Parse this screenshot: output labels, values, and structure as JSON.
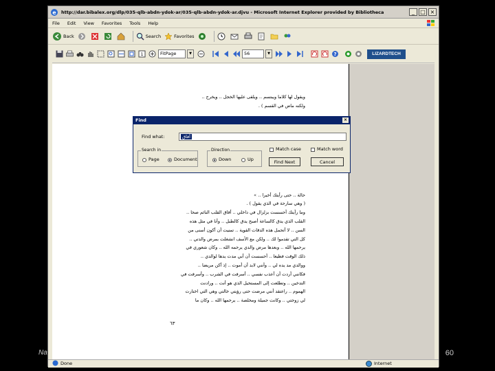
{
  "browser": {
    "title": "http://dar.bibalex.org/dlp/035-qlb-abdn-ydok-ar/035-qlb-abdn-ydok-ar.djvu - Microsoft Internet Explorer provided by Bibliotheca",
    "menu": [
      "File",
      "Edit",
      "View",
      "Favorites",
      "Tools",
      "Help"
    ],
    "toolbar": {
      "back": "Back",
      "search": "Search",
      "favorites": "Favorites"
    }
  },
  "viewer_toolbar": {
    "zoom_value": "FitPage",
    "page_value": "56",
    "logo": "LIZARDTECH"
  },
  "document": {
    "lines_top": [
      "ويقول لها كلاما ويبتسم .. ويلقى عليها الخجل .. ويخرج ..",
      "ولكنه ماض في القسم ) ."
    ],
    "lines_bottom": [
      "حالة .. حتى رأيتك أخيرا .. »",
      "( وهي سارحة في الذي يقول ) .",
      "وما رأيتك أحسست بزلزال في داخلي .. أفاق القلب النائم صحا ..",
      "القلب الذي يدق كالساعة أصبح يدق كالطبل .. وأنا في مثل هذه",
      "السن .. لا أتحمل هذه الدقات القوية .. تمنيت أن أكون أسنى من",
      "كل التي تقدموا لك .. ولكن مع الأسف انشغلت بمرض والدتي ..",
      "يرحمها الله .. وبعدها مرض والدي يرحمه الله .. وكان شعوري في",
      "ذلك الوقت فظيعا .. أحسست أن أبي مدت يدها لوالدي ..",
      "ووالدي مد يده لي .. وأنني لابد أن أموت .. إذ أكن مريضا ..",
      "فكانني أردت أن أعذب نفسي .. أسرفت في الشرب .. وأسرفت في",
      "التدخين .. وتطلعت إلى المستحيل الذي هو أنت .. ورادنت",
      "الهموم .. راعتقد أنني مرضت حتى رؤيتي خالتي وهي التي اختارت",
      "لي زوجتي .. وكانت جميلة ومخلصة .. يرحمها الله .. وكان ما"
    ],
    "page_number": "٦٣"
  },
  "find_dialog": {
    "title": "Find",
    "find_what_label": "Find what:",
    "find_value": "أفاق",
    "search_in_label": "Search in",
    "opt_page": "Page",
    "opt_document": "Document",
    "direction_label": "Direction",
    "opt_down": "Down",
    "opt_up": "Up",
    "match_case": "Match case",
    "match_word": "Match word",
    "find_next": "Find Next",
    "cancel": "Cancel"
  },
  "status": {
    "left": "Done",
    "zone": "Internet"
  },
  "slide": {
    "number": "60",
    "footer": "Na"
  }
}
